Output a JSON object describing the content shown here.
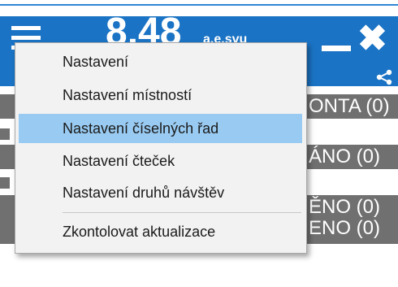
{
  "app": {
    "clock": "8.48",
    "clock_sub": "a.e.svu"
  },
  "status_rows": [
    {
      "text": "ONTA  (0)"
    },
    {
      "text": "ÁNO  (0)"
    },
    {
      "text_1": "ĚNO  (0)",
      "text_2": "ENO  (0)"
    }
  ],
  "menu": {
    "items": [
      {
        "label": "Nastavení",
        "selected": false
      },
      {
        "label": "Nastavení místností",
        "selected": false
      },
      {
        "label": "Nastavení číselných řad",
        "selected": true
      },
      {
        "label": "Nastavení čteček",
        "selected": false
      },
      {
        "label": "Nastavení druhů návštěv",
        "selected": false
      },
      {
        "label": "Zkontolovat aktualizace",
        "selected": false
      }
    ]
  },
  "colors": {
    "title_bar": "#1a73c4",
    "status_bg": "#707070",
    "menu_bg": "#f2f2f2",
    "menu_selected": "#99cbf2"
  },
  "icons": [
    "hamburger-icon",
    "minimize-icon",
    "close-icon",
    "share-icon"
  ]
}
